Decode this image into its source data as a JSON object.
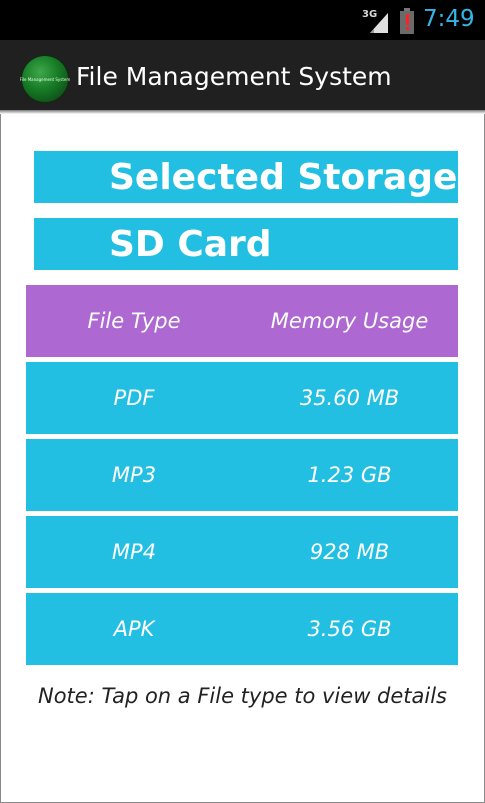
{
  "status_bar": {
    "network": "3G",
    "time": "7:49",
    "time_color": "#33b5e5"
  },
  "action_bar": {
    "logo_text": "File Management System",
    "title": "File Management System"
  },
  "storage": {
    "title": "Selected Storage",
    "name": "SD Card"
  },
  "table": {
    "headers": [
      "File Type",
      "Memory Usage"
    ],
    "rows": [
      {
        "type": "PDF",
        "usage": "35.60 MB"
      },
      {
        "type": "MP3",
        "usage": "1.23 GB"
      },
      {
        "type": "MP4",
        "usage": "928 MB"
      },
      {
        "type": "APK",
        "usage": "3.56 GB"
      }
    ]
  },
  "note": "Note: Tap on a File type to view details",
  "colors": {
    "accent_blue": "#22bfe2",
    "header_purple": "#ad68d2",
    "action_bar": "#202020"
  }
}
